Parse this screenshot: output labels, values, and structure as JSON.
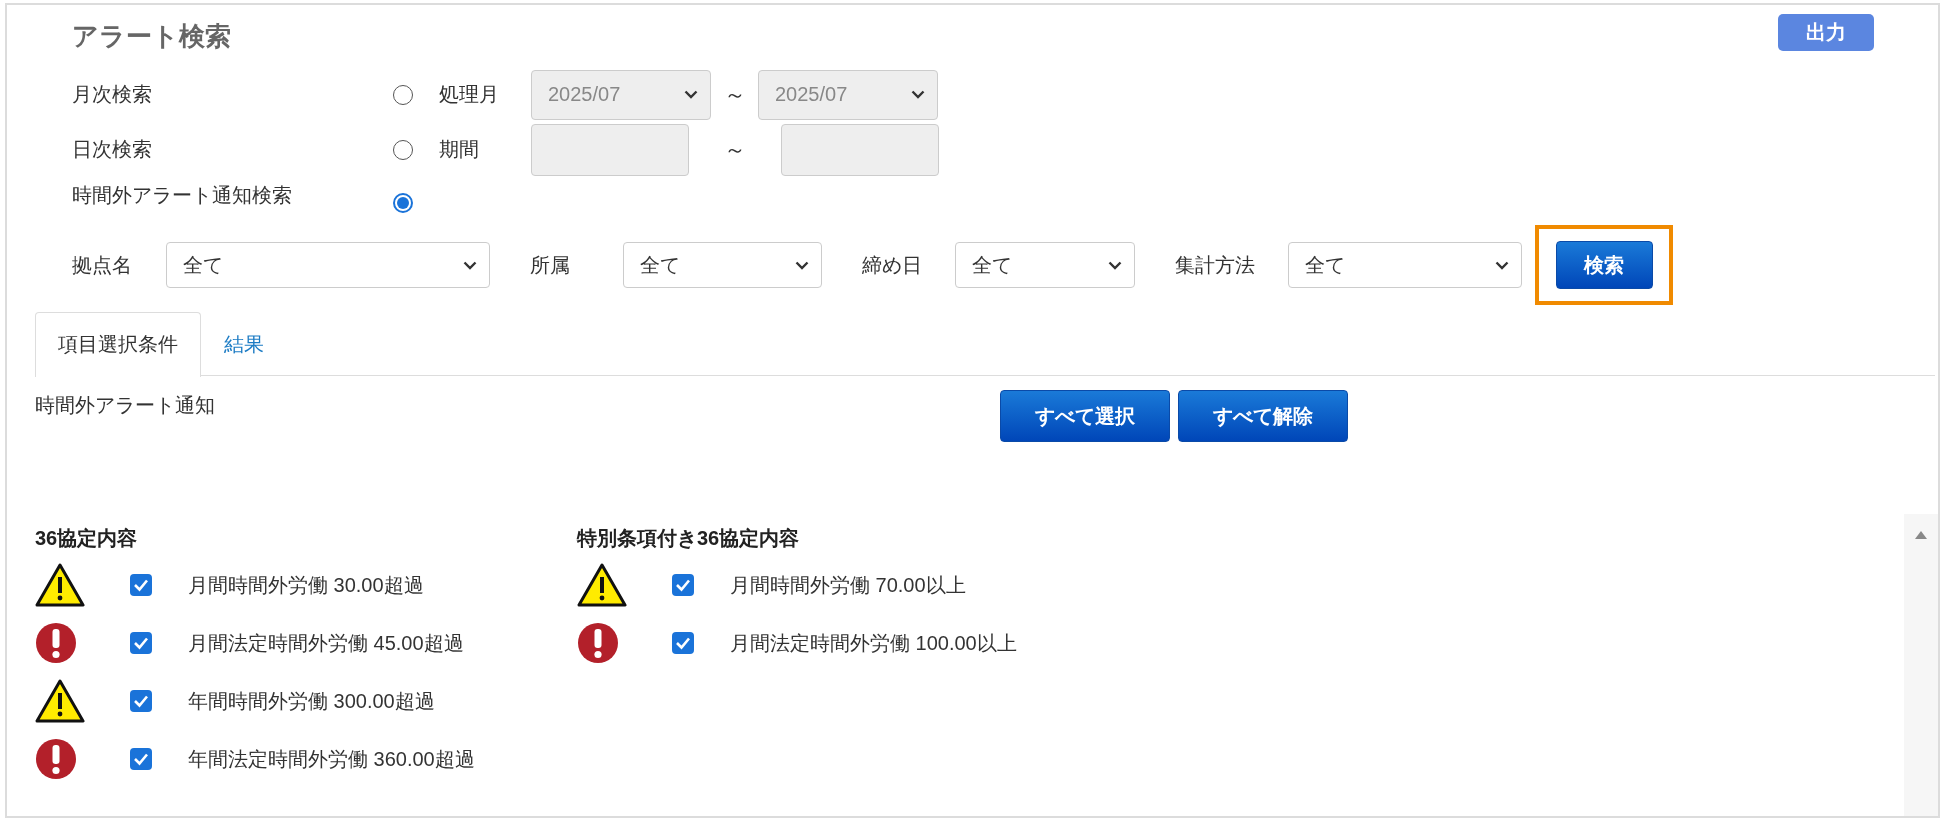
{
  "title": "アラート検索",
  "export_button": "出力",
  "search_modes": [
    {
      "kind": "month",
      "label": "月次検索",
      "selected": false,
      "field_label": "処理月",
      "disabled": true,
      "from": "2025/07",
      "separator": "～",
      "to": "2025/07"
    },
    {
      "kind": "period",
      "label": "日次検索",
      "selected": false,
      "field_label": "期間",
      "disabled": true,
      "separator": "～"
    },
    {
      "kind": "plain",
      "label": "時間外アラート通知検索",
      "selected": true
    }
  ],
  "filters": [
    {
      "label": "拠点名",
      "value": "全て"
    },
    {
      "label": "所属",
      "value": "全て"
    },
    {
      "label": "締め日",
      "value": "全て"
    },
    {
      "label": "集計方法",
      "value": "全て"
    }
  ],
  "search_button": {
    "label": "検索",
    "highlighted": true
  },
  "tabs": [
    {
      "label": "項目選択条件",
      "selected": true
    },
    {
      "label": "結果",
      "selected": false
    }
  ],
  "section_label": "時間外アラート通知",
  "select_all_button": "すべて選択",
  "clear_all_button": "すべて解除",
  "groups": [
    {
      "heading": "36協定内容",
      "items": [
        {
          "kind": "warning",
          "label": "月間時間外労働 30.00超過",
          "checked": true
        },
        {
          "kind": "error",
          "label": "月間法定時間外労働 45.00超過",
          "checked": true
        },
        {
          "kind": "warning",
          "label": "年間時間外労働 300.00超過",
          "checked": true
        },
        {
          "kind": "error",
          "label": "年間法定時間外労働 360.00超過",
          "checked": true
        }
      ]
    },
    {
      "heading": "特別条項付き36協定内容",
      "items": [
        {
          "kind": "warning",
          "label": "月間時間外労働 70.00以上",
          "checked": true
        },
        {
          "kind": "error",
          "label": "月間法定時間外労働 100.00以上",
          "checked": true
        }
      ]
    }
  ]
}
